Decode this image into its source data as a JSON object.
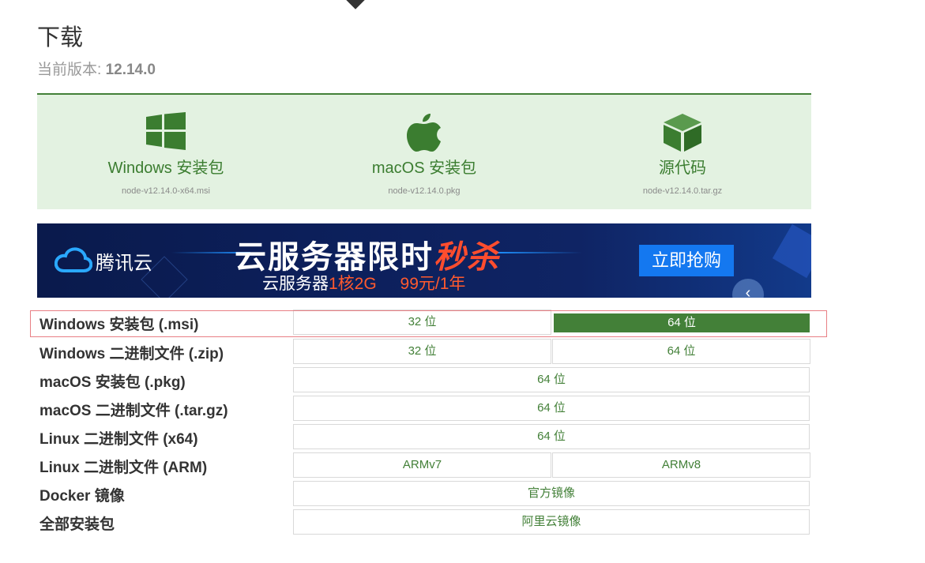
{
  "page": {
    "title": "下载",
    "version_label": "当前版本:",
    "version": "12.14.0"
  },
  "downloads": [
    {
      "label": "Windows 安装包",
      "file": "node-v12.14.0-x64.msi",
      "icon": "windows-icon"
    },
    {
      "label": "macOS 安装包",
      "file": "node-v12.14.0.pkg",
      "icon": "apple-icon"
    },
    {
      "label": "源代码",
      "file": "node-v12.14.0.tar.gz",
      "icon": "box-icon"
    }
  ],
  "banner": {
    "brand": "腾讯云",
    "headline_main": "云服务器限时",
    "headline_accent": "秒杀",
    "sub_prefix": "云服务器",
    "sub_accent": "1核2G",
    "sub_price": "99元/1年",
    "button": "立即抢购"
  },
  "table": {
    "rows": [
      {
        "label": "Windows 安装包 (.msi)",
        "cells": [
          "32 位",
          "64 位"
        ]
      },
      {
        "label": "Windows 二进制文件 (.zip)",
        "cells": [
          "32 位",
          "64 位"
        ]
      },
      {
        "label": "macOS 安装包 (.pkg)",
        "cells": [
          "64 位"
        ]
      },
      {
        "label": "macOS 二进制文件 (.tar.gz)",
        "cells": [
          "64 位"
        ]
      },
      {
        "label": "Linux 二进制文件 (x64)",
        "cells": [
          "64 位"
        ]
      },
      {
        "label": "Linux 二进制文件 (ARM)",
        "cells": [
          "ARMv7",
          "ARMv8"
        ]
      },
      {
        "label": "Docker 镜像",
        "cells": [
          "官方镜像"
        ]
      },
      {
        "label": "全部安装包",
        "cells": [
          "阿里云镜像"
        ]
      }
    ]
  },
  "colors": {
    "accent": "#438038",
    "panel_bg": "#e3f2e1",
    "highlight": "#e87f84"
  }
}
